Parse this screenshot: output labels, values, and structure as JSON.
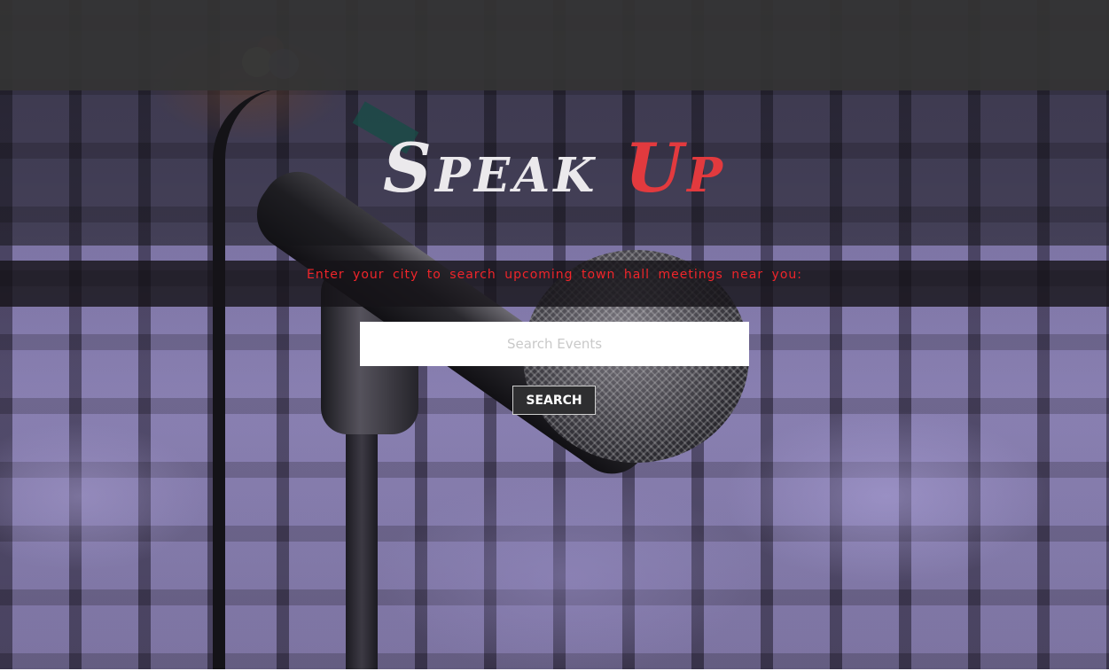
{
  "header": {
    "title_word_1": "Speak",
    "title_word_2": "Up",
    "title_colors": {
      "word_1": "#ebe9ec",
      "word_2": "#e23a3e"
    }
  },
  "search": {
    "prompt": "Enter your city to search upcoming town hall meetings near you:",
    "prompt_color": "#f0252a",
    "placeholder": "Search Events",
    "value": "",
    "button_label": "SEARCH"
  },
  "background": {
    "image": "auditorium-microphone-photo"
  }
}
